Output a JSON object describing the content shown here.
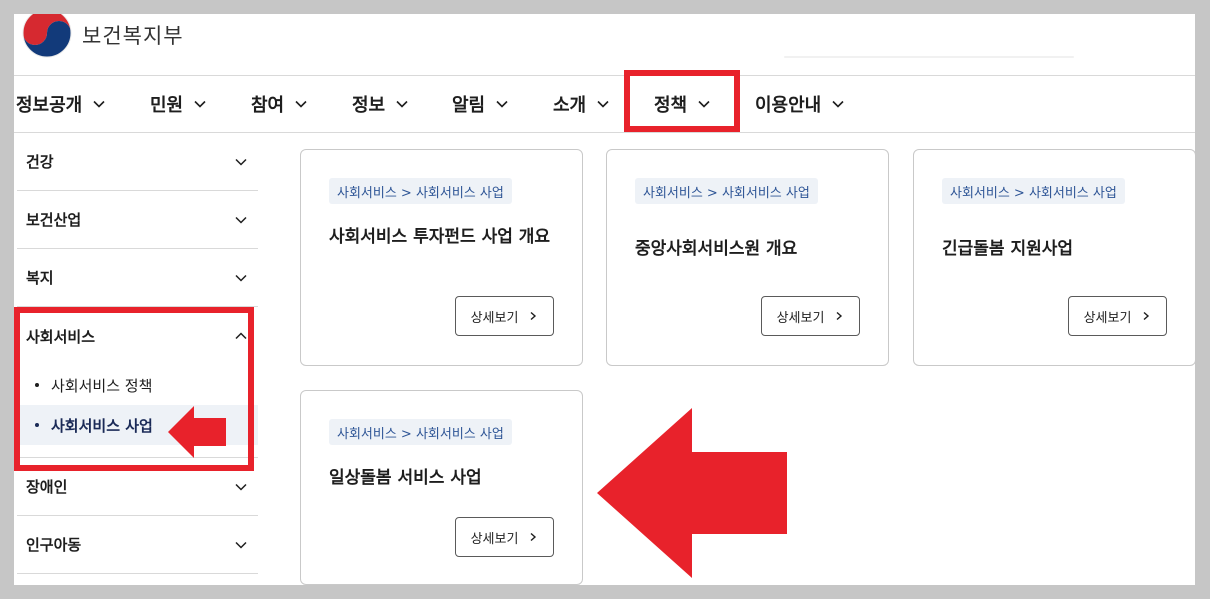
{
  "header": {
    "logo_text": "보건복지부",
    "logo_icon": "taegeuk-emblem-icon"
  },
  "gnb": {
    "items": [
      {
        "label": "정보공개"
      },
      {
        "label": "민원"
      },
      {
        "label": "참여"
      },
      {
        "label": "정보"
      },
      {
        "label": "알림"
      },
      {
        "label": "소개"
      },
      {
        "label": "정책"
      },
      {
        "label": "이용안내"
      }
    ],
    "highlighted": "정책"
  },
  "sidebar": {
    "items": [
      {
        "label": "건강"
      },
      {
        "label": "보건산업"
      },
      {
        "label": "복지"
      },
      {
        "label": "사회서비스",
        "open": true,
        "children": [
          {
            "label": "사회서비스 정책"
          },
          {
            "label": "사회서비스 사업",
            "active": true
          }
        ]
      },
      {
        "label": "장애인"
      },
      {
        "label": "인구아동"
      }
    ]
  },
  "cards": [
    {
      "tag": "사회서비스 > 사회서비스 사업",
      "title": "사회서비스 투자펀드 사업 개요",
      "button": "상세보기"
    },
    {
      "tag": "사회서비스 > 사회서비스 사업",
      "title": "중앙사회서비스원 개요",
      "button": "상세보기"
    },
    {
      "tag": "사회서비스 > 사회서비스 사업",
      "title": "긴급돌봄 지원사업",
      "button": "상세보기"
    },
    {
      "tag": "사회서비스 > 사회서비스 사업",
      "title": "일상돌봄 서비스 사업",
      "button": "상세보기"
    }
  ],
  "colors": {
    "annotation_red": "#e8222b",
    "tag_bg": "#eef2f7",
    "tag_text": "#2e5596",
    "active_text": "#1a2a57"
  }
}
